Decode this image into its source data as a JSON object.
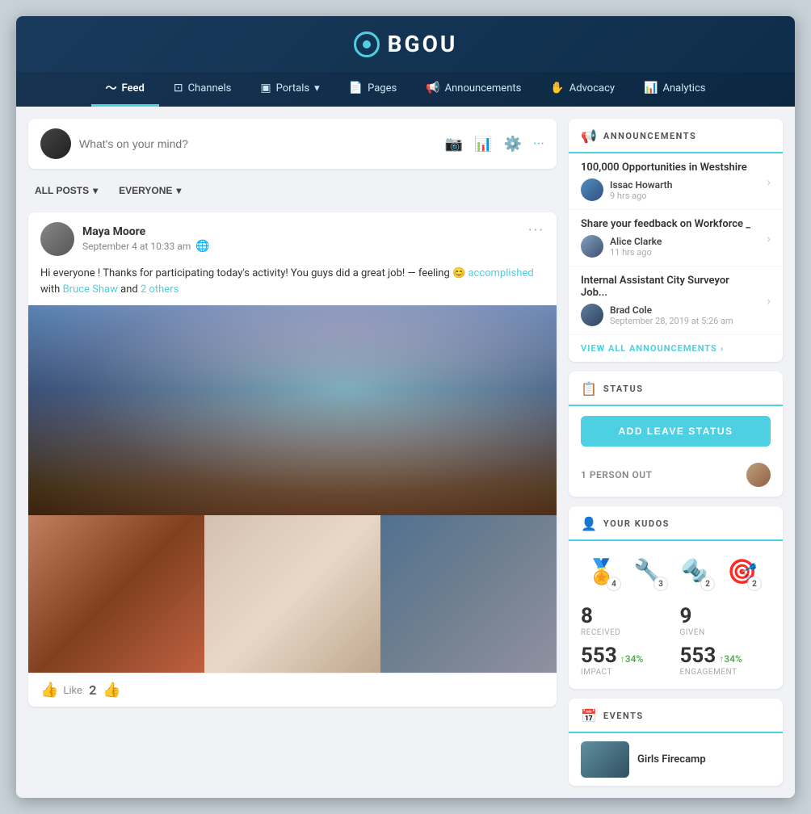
{
  "app": {
    "title": "BGOU"
  },
  "nav": {
    "items": [
      {
        "label": "Feed",
        "icon": "📶",
        "active": true
      },
      {
        "label": "Channels",
        "icon": "📺",
        "active": false
      },
      {
        "label": "Portals",
        "icon": "⬛",
        "active": false,
        "dropdown": true
      },
      {
        "label": "Pages",
        "icon": "📄",
        "active": false
      },
      {
        "label": "Announcements",
        "icon": "📢",
        "active": false
      },
      {
        "label": "Advocacy",
        "icon": "✋",
        "active": false
      },
      {
        "label": "Analytics",
        "icon": "📊",
        "active": false
      }
    ]
  },
  "compose": {
    "placeholder": "What's on your mind?"
  },
  "filters": {
    "posts_label": "ALL POSTS",
    "audience_label": "EVERYONE"
  },
  "post": {
    "author": "Maya Moore",
    "date": "September 4 at 10:33 am",
    "content_prefix": "Hi everyone ! Thanks for participating today's activity! You guys did a great job! — feeling 😊",
    "feeling_word": "accomplished",
    "content_mid": " with ",
    "tagged_user": "Bruce Shaw",
    "content_suffix": " and ",
    "others_count": "2 others",
    "like_label": "Like",
    "like_count": "2"
  },
  "sidebar": {
    "announcements": {
      "title": "ANNOUNCEMENTS",
      "items": [
        {
          "title": "100,000 Opportunities in Westshire",
          "author": "Issac Howarth",
          "time": "9 hrs ago"
        },
        {
          "title": "Share your feedback on Workforce _",
          "author": "Alice Clarke",
          "time": "11 hrs ago"
        },
        {
          "title": "Internal Assistant City Surveyor Job...",
          "author": "Brad Cole",
          "time": "September 28, 2019 at 5:26 am"
        }
      ],
      "view_all": "VIEW ALL ANNOUNCEMENTS"
    },
    "status": {
      "title": "STATUS",
      "add_button": "ADD LEAVE STATUS",
      "person_out": "1 PERSON OUT"
    },
    "kudos": {
      "title": "YOUR KUDOS",
      "badges": [
        {
          "icon": "🏅",
          "count": "4"
        },
        {
          "icon": "🔧",
          "count": "3"
        },
        {
          "icon": "🔩",
          "count": "2"
        },
        {
          "icon": "🎯",
          "count": "2"
        }
      ],
      "received_value": "8",
      "received_label": "RECEIVED",
      "given_value": "9",
      "given_label": "GIVEN",
      "impact_value": "553",
      "impact_trend": "↑34%",
      "impact_label": "IMPACT",
      "engagement_value": "553",
      "engagement_trend": "↑34%",
      "engagement_label": "ENGAGEMENT"
    },
    "events": {
      "title": "EVENTS",
      "item_title": "Girls Firecamp"
    }
  }
}
